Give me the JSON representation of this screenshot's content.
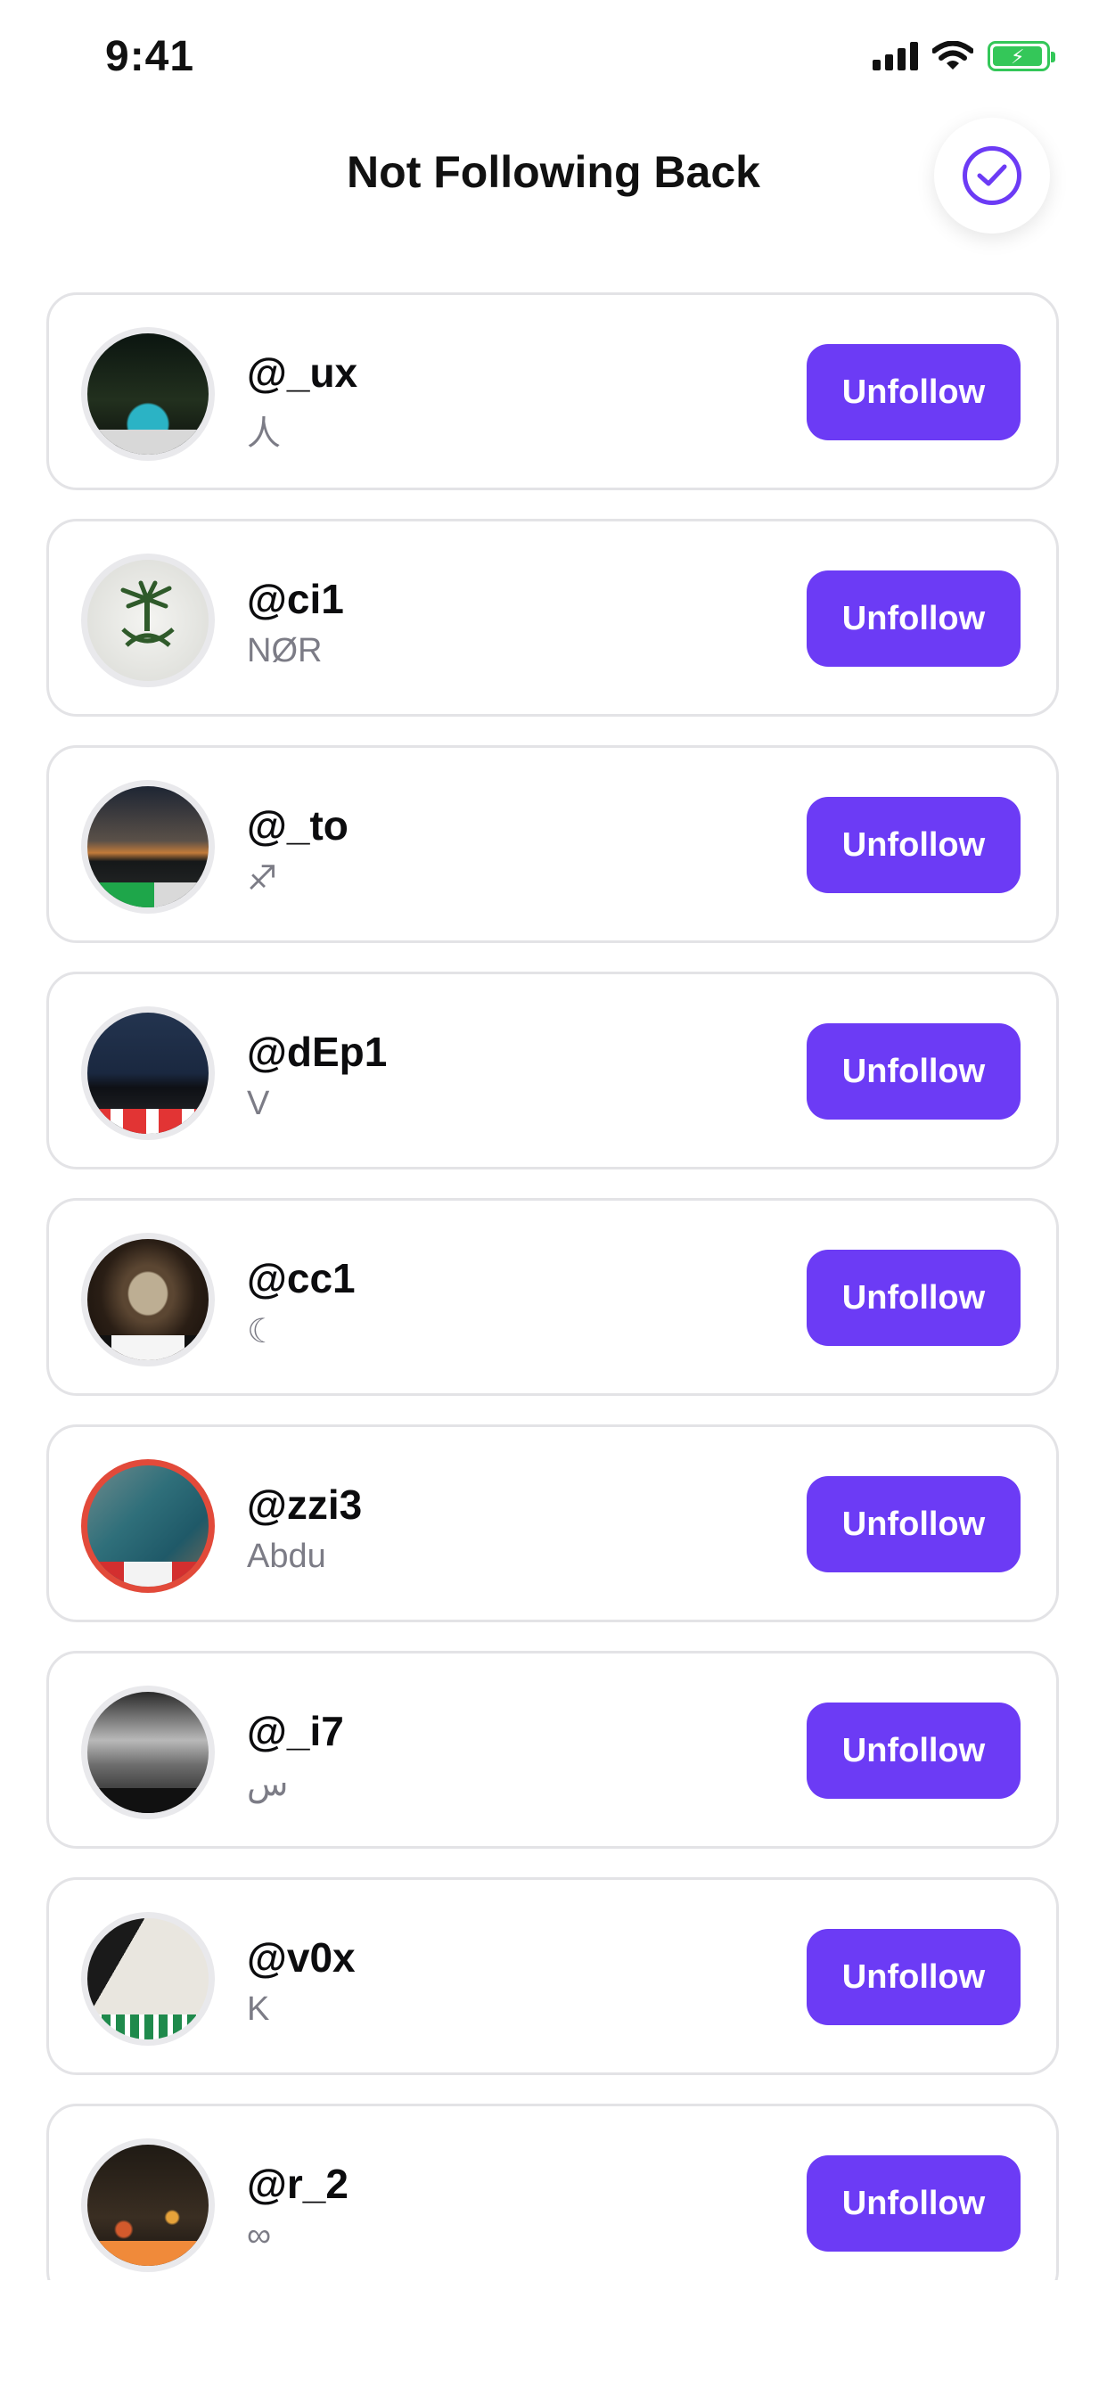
{
  "status_bar": {
    "time": "9:41",
    "icons": [
      "signal-icon",
      "wifi-icon",
      "battery-charging-icon"
    ]
  },
  "header": {
    "title": "Not Following Back",
    "action_icon": "check-circle-icon"
  },
  "accent_color": "#6c3bf5",
  "users": [
    {
      "username": "@_ux",
      "name": "人",
      "button_label": "Unfollow"
    },
    {
      "username": "@ci1",
      "name": "NØR",
      "button_label": "Unfollow"
    },
    {
      "username": "@_to",
      "name": "♐",
      "button_label": "Unfollow"
    },
    {
      "username": "@dEp1",
      "name": "V",
      "button_label": "Unfollow"
    },
    {
      "username": "@cc1",
      "name": "☾",
      "button_label": "Unfollow"
    },
    {
      "username": "@zzi3",
      "name": "Abdu",
      "button_label": "Unfollow"
    },
    {
      "username": "@_i7",
      "name": "س",
      "button_label": "Unfollow"
    },
    {
      "username": "@v0x",
      "name": "K",
      "button_label": "Unfollow"
    },
    {
      "username": "@r_2",
      "name": "∞",
      "button_label": "Unfollow"
    }
  ]
}
